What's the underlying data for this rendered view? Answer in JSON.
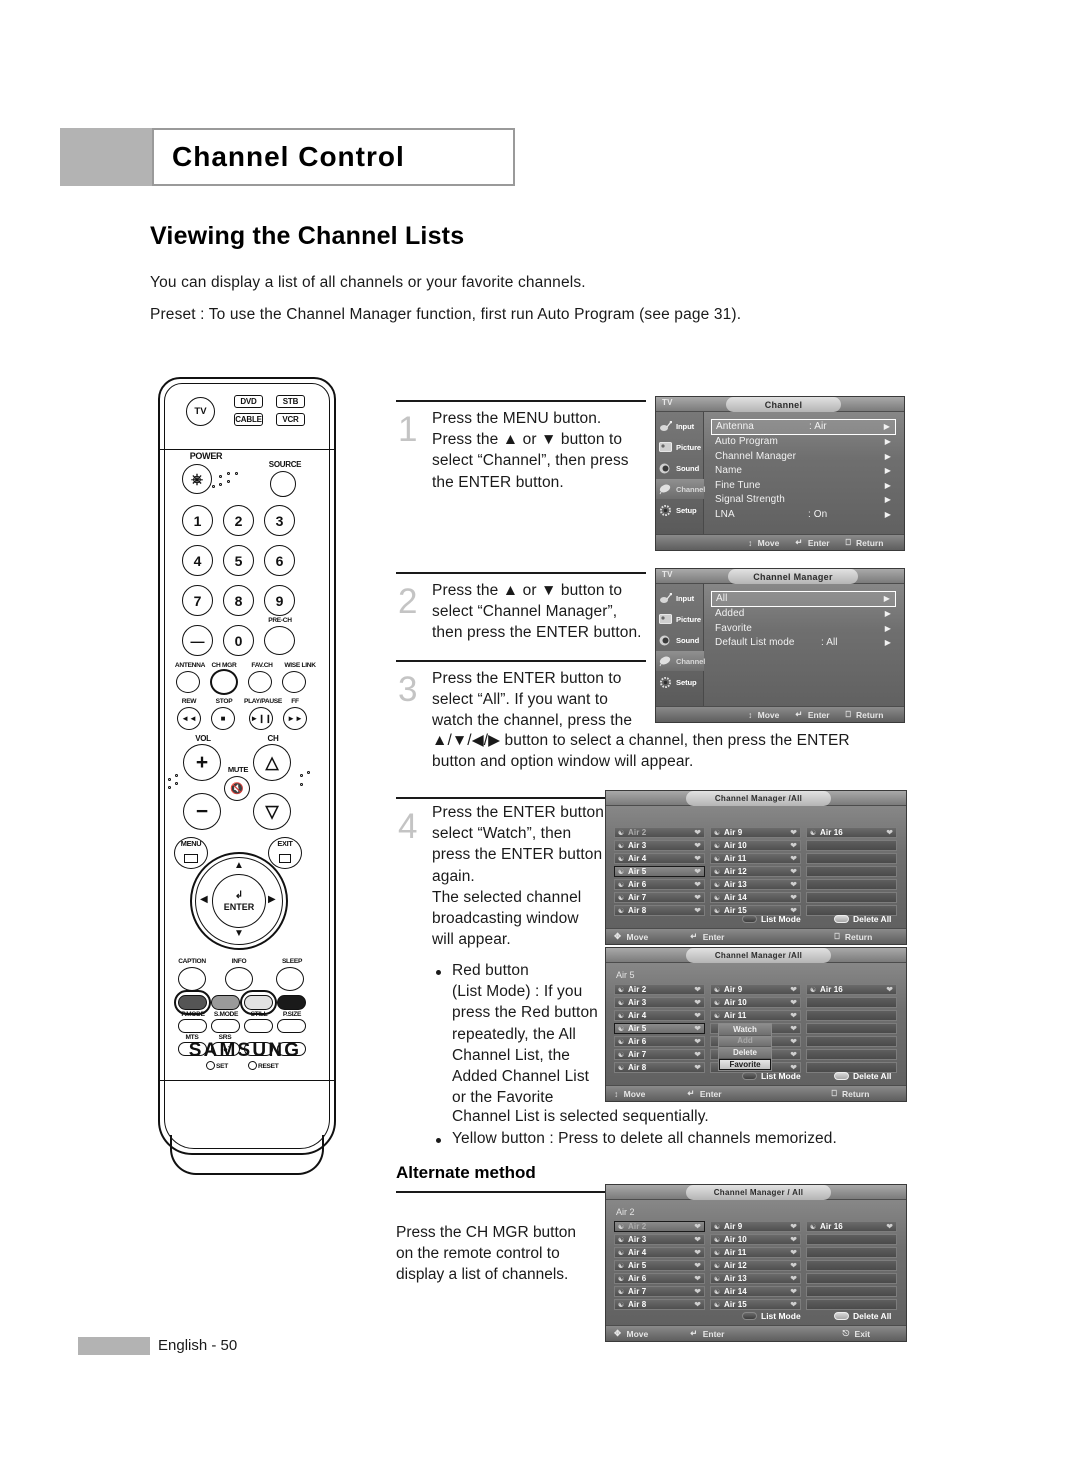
{
  "header": {
    "chapter_title": "Channel Control"
  },
  "section": {
    "title": "Viewing the Channel Lists",
    "intro_1": "You can display a list of all channels or your favorite channels.",
    "intro_2": "Preset : To use the Channel Manager function, first run Auto Program (see page 31)."
  },
  "remote": {
    "device_buttons": [
      "TV",
      "DVD",
      "STB",
      "CABLE",
      "VCR"
    ],
    "power_label": "POWER",
    "source_label": "SOURCE",
    "numbers": [
      "1",
      "2",
      "3",
      "4",
      "5",
      "6",
      "7",
      "8",
      "9",
      "0"
    ],
    "minus_label": "—",
    "pre_ch_label": "PRE-CH",
    "row_labels": [
      "ANTENNA",
      "CH MGR",
      "FAV.CH",
      "WISE LINK"
    ],
    "transport_labels": [
      "REW",
      "STOP",
      "PLAY/PAUSE",
      "FF"
    ],
    "vol_label": "VOL",
    "ch_label": "CH",
    "mute_label": "MUTE",
    "menu_label": "MENU",
    "exit_label": "EXIT",
    "enter_label": "ENTER",
    "bottom_labels": [
      "CAPTION",
      "INFO",
      "SLEEP"
    ],
    "color_labels": [
      "P.MODE",
      "S.MODE",
      "STILL",
      "P.SIZE"
    ],
    "mts_label": "MTS",
    "srs_label": "SRS",
    "set_label": "SET",
    "reset_label": "RESET",
    "brand": "SAMSUNG"
  },
  "steps": [
    {
      "number": "1",
      "lines": [
        "Press the MENU button.",
        "Press the ▲ or ▼ button to",
        "select “Channel”, then press",
        "the ENTER button."
      ]
    },
    {
      "number": "2",
      "lines": [
        "Press the ▲ or ▼ button to",
        "select “Channel Manager”,",
        "then press the ENTER button."
      ]
    },
    {
      "number": "3",
      "lines": [
        "Press the ENTER button to",
        "select “All”. If you want to",
        "watch the channel, press the"
      ],
      "wide_lines": [
        "▲/▼/◀/▶ button to select a channel, then press the ENTER",
        "button and option window will appear."
      ]
    },
    {
      "number": "4",
      "lines": [
        "Press the ENTER button",
        "select “Watch”, then",
        "press the ENTER button",
        "again.",
        "The selected channel",
        "broadcasting window",
        "will appear."
      ]
    }
  ],
  "bullets": {
    "red": [
      "Red button",
      "(List Mode) : If you",
      "press the Red button",
      "repeatedly, the All",
      "Channel List, the",
      "Added Channel List",
      "or the Favorite"
    ],
    "red_tail": "Channel List is selected sequentially.",
    "yellow": "Yellow button : Press to delete all channels memorized."
  },
  "alternate": {
    "title": "Alternate method",
    "lines": [
      "Press the CH MGR button",
      "on the remote control to",
      "display a list of channels."
    ]
  },
  "osd_sidebar": [
    {
      "name": "Input",
      "icon": "input-icon"
    },
    {
      "name": "Picture",
      "icon": "picture-icon"
    },
    {
      "name": "Sound",
      "icon": "sound-icon"
    },
    {
      "name": "Channel",
      "icon": "channel-icon"
    },
    {
      "name": "Setup",
      "icon": "setup-icon"
    }
  ],
  "osd_channel": {
    "tv_label": "TV",
    "title": "Channel",
    "rows": [
      {
        "label": "Antenna",
        "value": ": Air",
        "highlighted": true
      },
      {
        "label": "Auto Program",
        "value": "",
        "highlighted": false
      },
      {
        "label": "Channel Manager",
        "value": "",
        "highlighted": false
      },
      {
        "label": "Name",
        "value": "",
        "highlighted": false
      },
      {
        "label": "Fine Tune",
        "value": "",
        "highlighted": false
      },
      {
        "label": "Signal Strength",
        "value": "",
        "highlighted": false
      },
      {
        "label": "LNA",
        "value": ": On",
        "highlighted": false
      }
    ],
    "footer": [
      "Move",
      "Enter",
      "Return"
    ]
  },
  "osd_channel_manager": {
    "tv_label": "TV",
    "title": "Channel Manager",
    "rows": [
      {
        "label": "All",
        "value": "",
        "highlighted": true
      },
      {
        "label": "Added",
        "value": "",
        "highlighted": false
      },
      {
        "label": "Favorite",
        "value": "",
        "highlighted": false
      },
      {
        "label": "Default List mode",
        "value": ": All",
        "highlighted": false
      }
    ],
    "footer": [
      "Move",
      "Enter",
      "Return"
    ]
  },
  "channel_list_1": {
    "title": "Channel Manager /All",
    "current": "",
    "col1": [
      "Air 2",
      "Air 3",
      "Air 4",
      "Air 5",
      "Air 6",
      "Air 7",
      "Air 8"
    ],
    "col2": [
      "Air 9",
      "Air 10",
      "Air 11",
      "Air 12",
      "Air 13",
      "Air 14",
      "Air 15"
    ],
    "col3": [
      "Air 16",
      "",
      "",
      "",
      "",
      "",
      ""
    ],
    "selected_index": 3,
    "dim_index": 0,
    "btn_red": "List Mode",
    "btn_yellow": "Delete All",
    "footer": [
      "Move",
      "Enter",
      "Return"
    ]
  },
  "channel_list_2": {
    "title": "Channel Manager /All",
    "current": "Air 5",
    "col1": [
      "Air 2",
      "Air 3",
      "Air 4",
      "Air 5",
      "Air 6",
      "Air 7",
      "Air 8"
    ],
    "col2": [
      "Air 9",
      "Air 10",
      "Air 11",
      "Air 12",
      "Air 13",
      "Air 14",
      "Air 15"
    ],
    "col3": [
      "Air 16",
      "",
      "",
      "",
      "",
      "",
      ""
    ],
    "selected_index": 3,
    "popup": [
      {
        "label": "Watch",
        "state": "normal"
      },
      {
        "label": "Add",
        "state": "disabled"
      },
      {
        "label": "Delete",
        "state": "normal"
      },
      {
        "label": "Favorite",
        "state": "selected"
      }
    ],
    "btn_red": "List Mode",
    "btn_yellow": "Delete All",
    "footer": [
      "Move",
      "Enter",
      "Return"
    ]
  },
  "channel_list_3": {
    "title": "Channel Manager / All",
    "current": "Air 2",
    "col1": [
      "Air 2",
      "Air 3",
      "Air 4",
      "Air 5",
      "Air 6",
      "Air 7",
      "Air 8"
    ],
    "col2": [
      "Air 9",
      "Air 10",
      "Air 11",
      "Air 12",
      "Air 13",
      "Air 14",
      "Air 15"
    ],
    "col3": [
      "Air 16",
      "",
      "",
      "",
      "",
      "",
      ""
    ],
    "selected_index": 0,
    "btn_red": "List Mode",
    "btn_yellow": "Delete All",
    "footer": [
      "Move",
      "Enter",
      "Exit"
    ]
  },
  "page_footer": {
    "text": "English - 50"
  },
  "colors": {
    "header_gray": "#b3b3b3",
    "step_number_gray": "#c4c4c4",
    "osd_gray": "#6f6f6f",
    "text_black": "#1a1a1a"
  }
}
